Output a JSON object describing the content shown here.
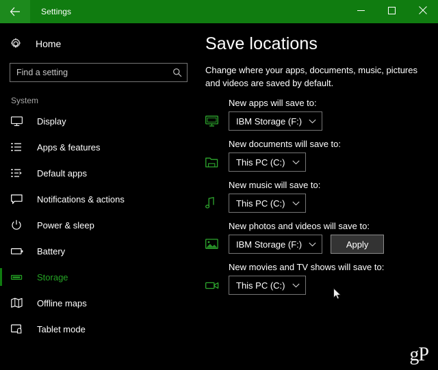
{
  "window": {
    "title": "Settings",
    "accent_green": "#107c10",
    "selected_green": "#25a525",
    "back_icon": "back-arrow-icon",
    "minimize_icon": "minimize-icon",
    "maximize_icon": "maximize-icon",
    "close_icon": "close-icon"
  },
  "sidebar": {
    "home": {
      "label": "Home",
      "icon": "gear-icon"
    },
    "search": {
      "placeholder": "Find a setting",
      "value": "",
      "icon": "search-icon"
    },
    "group_label": "System",
    "items": [
      {
        "label": "Display",
        "icon": "monitor-icon",
        "selected": false
      },
      {
        "label": "Apps & features",
        "icon": "list-icon",
        "selected": false
      },
      {
        "label": "Default apps",
        "icon": "list-arrow-icon",
        "selected": false
      },
      {
        "label": "Notifications & actions",
        "icon": "speech-bubble-icon",
        "selected": false
      },
      {
        "label": "Power & sleep",
        "icon": "power-icon",
        "selected": false
      },
      {
        "label": "Battery",
        "icon": "battery-icon",
        "selected": false
      },
      {
        "label": "Storage",
        "icon": "drive-icon",
        "selected": true
      },
      {
        "label": "Offline maps",
        "icon": "map-icon",
        "selected": false
      },
      {
        "label": "Tablet mode",
        "icon": "tablet-icon",
        "selected": false
      }
    ]
  },
  "main": {
    "title": "Save locations",
    "description": "Change where your apps, documents, music, pictures and videos are saved by default.",
    "rows": [
      {
        "label": "New apps will save to:",
        "icon": "apps-monitor-icon",
        "value": "IBM Storage (F:)",
        "chevron": "chevron-down-icon",
        "has_apply": false
      },
      {
        "label": "New documents will save to:",
        "icon": "documents-folder-icon",
        "value": "This PC (C:)",
        "chevron": "chevron-down-icon",
        "has_apply": false
      },
      {
        "label": "New music will save to:",
        "icon": "music-note-icon",
        "value": "This PC (C:)",
        "chevron": "chevron-down-icon",
        "has_apply": false
      },
      {
        "label": "New photos and videos will save to:",
        "icon": "photo-icon",
        "value": "IBM Storage (F:)",
        "chevron": "chevron-down-icon",
        "has_apply": true,
        "apply_label": "Apply"
      },
      {
        "label": "New movies and TV shows will save to:",
        "icon": "video-camera-icon",
        "value": "This PC (C:)",
        "chevron": "chevron-down-icon",
        "has_apply": false
      }
    ],
    "watermark": "gP"
  }
}
